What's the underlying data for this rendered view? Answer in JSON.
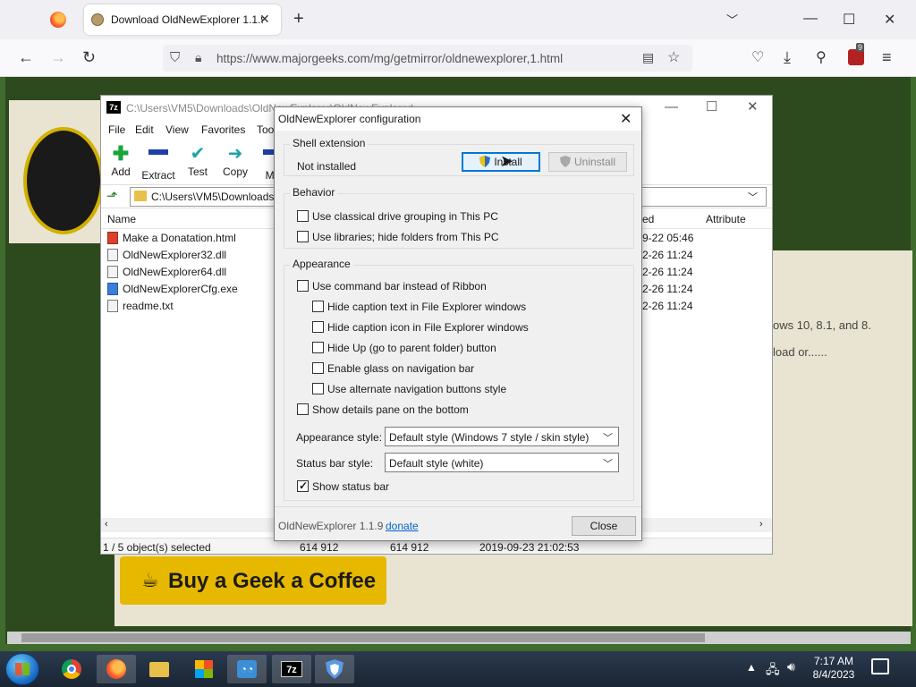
{
  "browser": {
    "tab_title": "Download OldNewExplorer 1.1.9",
    "url_host": "https://www.majorgeeks.com",
    "url_path": "/mg/getmirror/oldnewexplorer,1.html",
    "extension_badge": "9"
  },
  "page": {
    "coffee_label": "Buy a Geek a Coffee",
    "snippet_1": "ows 10, 8.1, and 8.",
    "snippet_2": "load or......"
  },
  "sevenzip": {
    "title": "C:\\Users\\VM5\\Downloads\\OldNewExplorer\\OldNewExplorer\\",
    "menu": [
      "File",
      "Edit",
      "View",
      "Favorites",
      "Tools"
    ],
    "toolbar": [
      "Add",
      "Extract",
      "Test",
      "Copy",
      "Mo"
    ],
    "address": "C:\\Users\\VM5\\Downloads",
    "columns": {
      "name": "Name",
      "modified": "ed",
      "attributes": "Attribute"
    },
    "files": [
      {
        "name": "Make a Donatation.html",
        "date": "9-22 05:46"
      },
      {
        "name": "OldNewExplorer32.dll",
        "date": "2-26 11:24"
      },
      {
        "name": "OldNewExplorer64.dll",
        "date": "2-26 11:24"
      },
      {
        "name": "OldNewExplorerCfg.exe",
        "date": "2-26 11:24"
      },
      {
        "name": "readme.txt",
        "date": "2-26 11:24"
      }
    ],
    "status": {
      "selected": "1 / 5 object(s) selected",
      "size": "614 912",
      "packed": "614 912",
      "modified": "2019-09-23 21:02:53"
    }
  },
  "dialog": {
    "title": "OldNewExplorer configuration",
    "shell": {
      "legend": "Shell extension",
      "status": "Not installed",
      "install": "Install",
      "uninstall": "Uninstall"
    },
    "behavior": {
      "legend": "Behavior",
      "opt1": "Use classical drive grouping in This PC",
      "opt2": "Use libraries; hide folders from This PC"
    },
    "appearance": {
      "legend": "Appearance",
      "cmdbar": "Use command bar instead of Ribbon",
      "caption_text": "Hide caption text in File Explorer windows",
      "caption_icon": "Hide caption icon in File Explorer windows",
      "hide_up": "Hide Up (go to parent folder) button",
      "glass": "Enable glass on navigation bar",
      "alt_nav": "Use alternate navigation buttons style",
      "details": "Show details pane on the bottom",
      "style_label": "Appearance style:",
      "style_value": "Default style (Windows 7 style / skin style)",
      "status_label": "Status bar style:",
      "status_value": "Default style (white)",
      "show_status": "Show status bar",
      "show_status_checked": true
    },
    "footer": {
      "version": "OldNewExplorer 1.1.9",
      "donate": "donate",
      "close": "Close"
    }
  },
  "taskbar": {
    "time": "7:17 AM",
    "date": "8/4/2023"
  },
  "colors": {
    "accent": "#0078d7",
    "taskbar": "#1f2b3a",
    "coffee": "#e6b800"
  }
}
